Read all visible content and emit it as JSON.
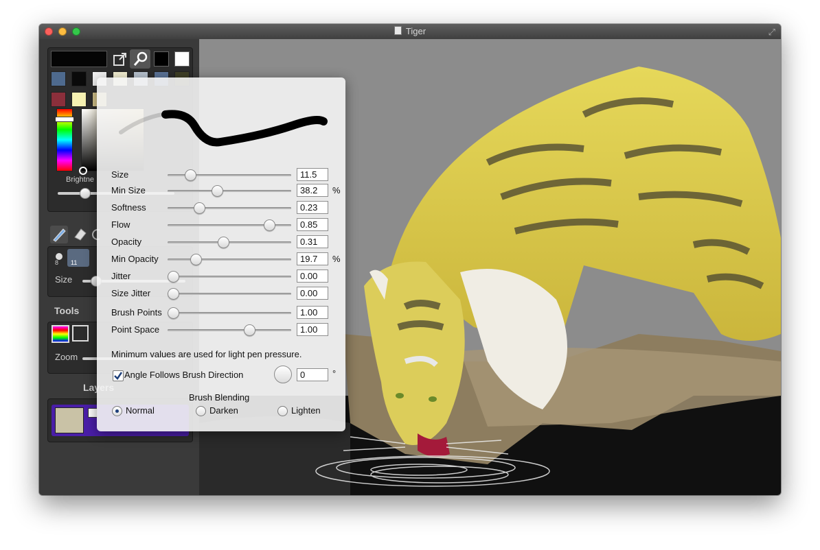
{
  "window": {
    "title": "Tiger"
  },
  "sidebar": {
    "brightness_label": "Brightne",
    "brush_badges": [
      "8",
      "11"
    ],
    "size_label": "Size",
    "tools_title": "Tools",
    "zoom_label": "Zoom",
    "layers_title": "Layers"
  },
  "palette": {
    "swatches": [
      "#4e6a8e",
      "#0a0a0a",
      "#f2f2f2",
      "#f3efd2",
      "#b8c3cf",
      "#5c7498",
      "#3f3f26",
      "#8b2f3b",
      "#f6f1b2",
      "#d6c58c"
    ]
  },
  "brush_popover": {
    "sliders": [
      {
        "label": "Size",
        "value": "11.5",
        "unit": "",
        "pos": 0.15
      },
      {
        "label": "Min Size",
        "value": "38.2",
        "unit": "%",
        "pos": 0.39
      },
      {
        "label": "Softness",
        "value": "0.23",
        "unit": "",
        "pos": 0.23
      },
      {
        "label": "Flow",
        "value": "0.85",
        "unit": "",
        "pos": 0.85
      },
      {
        "label": "Opacity",
        "value": "0.31",
        "unit": "",
        "pos": 0.44
      },
      {
        "label": "Min Opacity",
        "value": "19.7",
        "unit": "%",
        "pos": 0.2
      },
      {
        "label": "Jitter",
        "value": "0.00",
        "unit": "",
        "pos": 0.0
      },
      {
        "label": "Size Jitter",
        "value": "0.00",
        "unit": "",
        "pos": 0.0
      },
      {
        "label": "Brush Points",
        "value": "1.00",
        "unit": "",
        "pos": 0.0
      },
      {
        "label": "Point Space",
        "value": "1.00",
        "unit": "",
        "pos": 0.67
      }
    ],
    "pressure_note": "Minimum values are used for light pen pressure.",
    "angle_follows_label": "Angle Follows Brush Direction",
    "angle_follows_checked": true,
    "angle_value": "0",
    "angle_unit": "°",
    "blending_title": "Brush Blending",
    "blending_options": [
      "Normal",
      "Darken",
      "Lighten"
    ],
    "blending_selected": "Normal"
  },
  "colors": {
    "accent": "#2a63c6",
    "layer_highlight": "#4a1ea8",
    "popover_bg": "#f4f4f4"
  }
}
